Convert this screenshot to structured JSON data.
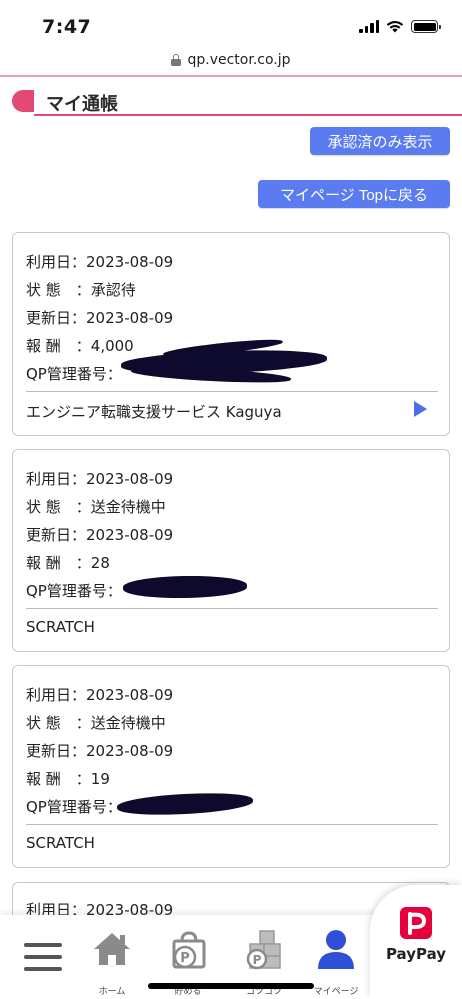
{
  "status_bar": {
    "time": "7:47"
  },
  "browser": {
    "url": "qp.vector.co.jp"
  },
  "page": {
    "title": "マイ通帳",
    "approved_only_button": "承認済のみ表示",
    "mypage_top_button": "マイページ Topに戻る"
  },
  "labels": {
    "use_date": "利用日：",
    "status": "状 態　：",
    "updated": "更新日：",
    "reward": "報 酬　：",
    "qp_number": "QP管理番号："
  },
  "records": [
    {
      "use_date": "2023-08-09",
      "status": "承認待",
      "updated": "2023-08-09",
      "reward": "4,000",
      "service": "エンジニア転職支援サービス Kaguya"
    },
    {
      "use_date": "2023-08-09",
      "status": "送金待機中",
      "updated": "2023-08-09",
      "reward": "28",
      "service": "SCRATCH"
    },
    {
      "use_date": "2023-08-09",
      "status": "送金待機中",
      "updated": "2023-08-09",
      "reward": "19",
      "service": "SCRATCH"
    },
    {
      "use_date": "2023-08-09"
    }
  ],
  "nav": {
    "home": "ホーム",
    "save": "貯める",
    "tips": "コツコツ",
    "mypage": "マイページ",
    "paypay": "PayPay"
  },
  "colors": {
    "accent_pink": "#e24a74",
    "button_blue": "#5a7cf0",
    "nav_active": "#2f4fd6"
  }
}
